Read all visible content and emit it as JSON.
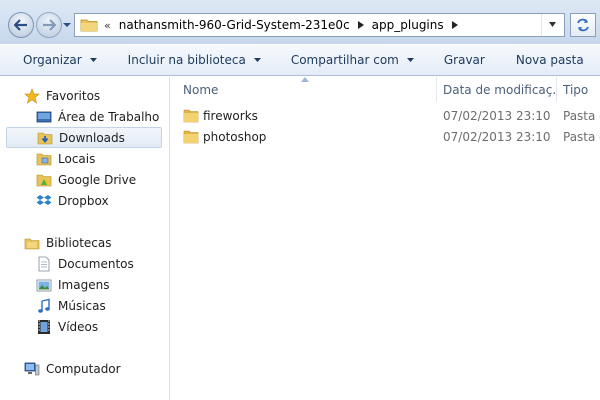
{
  "address": {
    "overflow_chevron": "«",
    "crumbs": [
      "nathansmith-960-Grid-System-231e0c",
      "app_plugins"
    ]
  },
  "toolbar": {
    "organize": "Organizar",
    "include_library": "Incluir na biblioteca",
    "share_with": "Compartilhar com",
    "burn": "Gravar",
    "new_folder": "Nova pasta"
  },
  "nav": {
    "favorites": "Favoritos",
    "desktop": "Área de Trabalho",
    "downloads": "Downloads",
    "recent": "Locais",
    "google_drive": "Google Drive",
    "dropbox": "Dropbox",
    "libraries": "Bibliotecas",
    "documents": "Documentos",
    "pictures": "Imagens",
    "music": "Músicas",
    "videos": "Vídeos",
    "computer": "Computador"
  },
  "columns": {
    "name": "Nome",
    "date": "Data de modificaç...",
    "type": "Tipo"
  },
  "files": [
    {
      "name": "fireworks",
      "date": "07/02/2013 23:10",
      "type": "Pasta d"
    },
    {
      "name": "photoshop",
      "date": "07/02/2013 23:10",
      "type": "Pasta d"
    }
  ]
}
